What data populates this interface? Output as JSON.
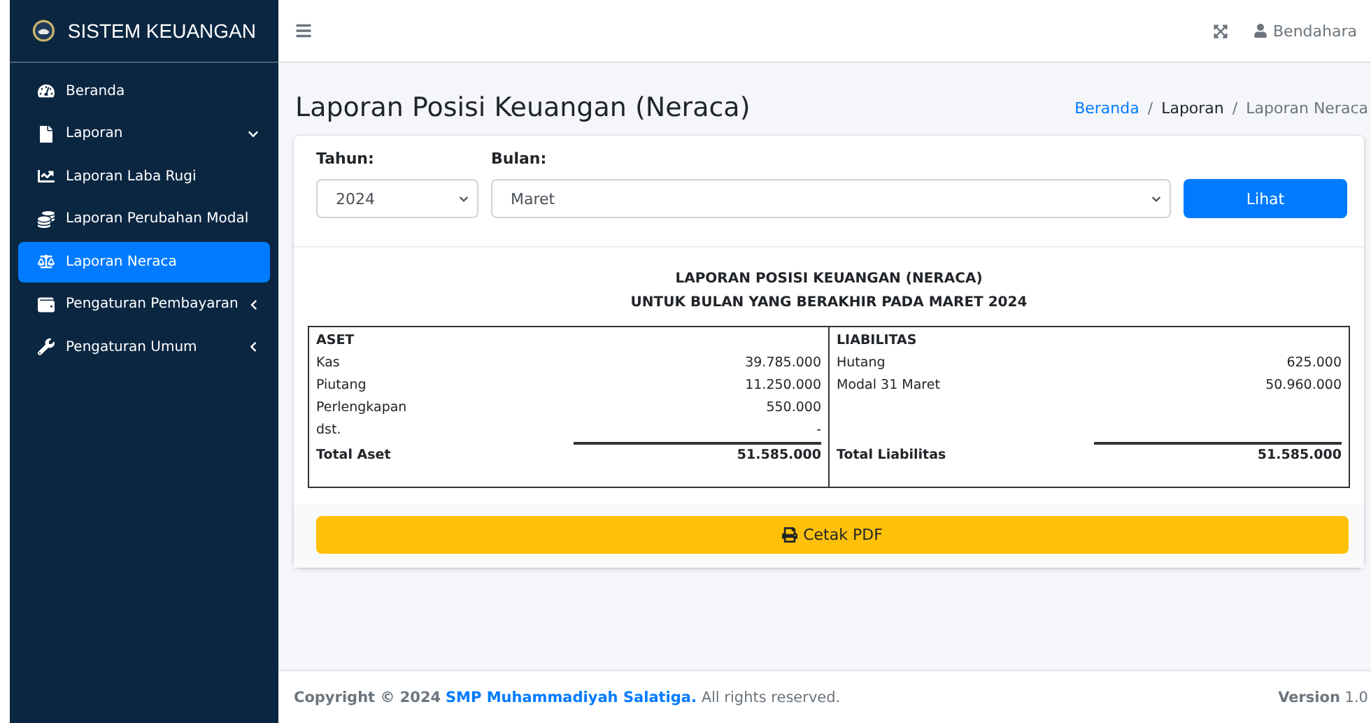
{
  "sidebar": {
    "brand": "SISTEM KEUANGAN",
    "items": [
      {
        "label": "Beranda",
        "selected": false
      },
      {
        "label": "Laporan",
        "selected": false,
        "expanded": true,
        "children": [
          {
            "label": "Laporan Laba Rugi",
            "selected": false
          },
          {
            "label": "Laporan Perubahan Modal",
            "selected": false
          },
          {
            "label": "Laporan Neraca",
            "selected": true
          }
        ]
      },
      {
        "label": "Pengaturan Pembayaran",
        "selected": false,
        "expanded": false
      },
      {
        "label": "Pengaturan Umum",
        "selected": false,
        "expanded": false
      }
    ]
  },
  "topbar": {
    "user": "Bendahara"
  },
  "page_title": "Laporan Posisi Keuangan (Neraca)",
  "breadcrumb": [
    "Beranda",
    "Laporan",
    "Laporan Neraca"
  ],
  "breadcrumb_separator": "/",
  "filters": {
    "year_label": "Tahun:",
    "year": "2024",
    "month_label": "Bulan:",
    "month": "Maret",
    "button": "Lihat"
  },
  "report": {
    "title": "LAPORAN POSISI KEUANGAN (NERACA)",
    "subtitle": "UNTUK BULAN YANG BERAKHIR PADA MARET 2024",
    "left": {
      "heading": "ASET",
      "rows": [
        {
          "label": "Kas",
          "value": "39.785.000"
        },
        {
          "label": "Piutang",
          "value": "11.250.000"
        },
        {
          "label": "Perlengkapan",
          "value": "550.000"
        },
        {
          "label": "dst.",
          "value": "-"
        }
      ],
      "total_label": "Total Aset",
      "total": "51.585.000"
    },
    "right": {
      "heading": "LIABILITAS",
      "rows": [
        {
          "label": "Hutang",
          "value": "625.000"
        },
        {
          "label": "Modal 31 Maret",
          "value": "50.960.000"
        }
      ],
      "total_label": "Total Liabilitas",
      "total": "51.585.000"
    }
  },
  "print_button": "Cetak PDF",
  "footer": {
    "copyright": "Copyright © 2024",
    "link": "SMP Muhammadiyah Salatiga.",
    "rights": "All rights reserved.",
    "version": "**Version** 1.0"
  }
}
